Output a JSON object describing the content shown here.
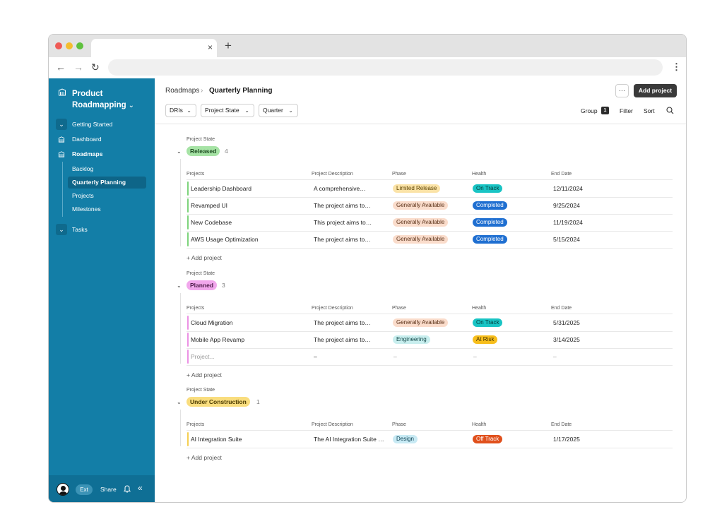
{
  "browser": {
    "tab_close": "×",
    "new_tab": "+",
    "back": "←",
    "forward": "→",
    "reload": "↻",
    "menu": "⋮"
  },
  "sidebar": {
    "app_title": "Product Roadmapping",
    "title_chevron": "⌄",
    "items": [
      {
        "label": "Getting Started",
        "icon": "chevron-down-icon"
      },
      {
        "label": "Dashboard",
        "icon": "building-icon"
      },
      {
        "label": "Roadmaps",
        "icon": "building-icon"
      },
      {
        "label": "Tasks",
        "icon": "chevron-down-icon"
      }
    ],
    "sub_items": [
      "Backlog",
      "Quarterly Planning",
      "Projects",
      "Milestones"
    ],
    "active_sub_item": "Quarterly Planning",
    "footer": {
      "ext_label": "Ext",
      "share_label": "Share",
      "collapse_icon": "«"
    }
  },
  "header": {
    "breadcrumb_parent": "Roadmaps",
    "breadcrumb_sep": "›",
    "breadcrumb_current": "Quarterly Planning",
    "more_label": "···",
    "add_project_label": "Add project",
    "filters": [
      {
        "label": "DRIs",
        "chevron": "⌄"
      },
      {
        "label": "Project State",
        "chevron": "⌄"
      },
      {
        "label": "Quarter",
        "chevron": "⌄"
      }
    ],
    "group_label": "Group",
    "group_count": "1",
    "filter_label": "Filter",
    "sort_label": "Sort"
  },
  "columns": [
    "Projects",
    "Project Description",
    "Phase",
    "Health",
    "End Date"
  ],
  "groups": [
    {
      "caption": "Project State",
      "toggle": "⌄",
      "state": "Released",
      "count": "4",
      "pill_bg": "#a6e3a5",
      "pill_fg": "#1f4d22",
      "bar_color": "#7ed47c",
      "add_label": "+ Add project",
      "rows": [
        {
          "name": "Leadership Dashboard",
          "desc": "A comprehensive…",
          "phase": "Limited Release",
          "phase_bg": "#fbe3a7",
          "phase_fg": "#5a4100",
          "health": "On Track",
          "health_bg": "#19c4c4",
          "health_fg": "#053b3b",
          "date": "12/11/2024"
        },
        {
          "name": "Revamped UI",
          "desc": "The project aims to…",
          "phase": "Generally Available",
          "phase_bg": "#fadccb",
          "phase_fg": "#5a3118",
          "health": "Completed",
          "health_bg": "#1f6fd1",
          "health_fg": "#ffffff",
          "date": "9/25/2024"
        },
        {
          "name": "New Codebase",
          "desc": "This project aims to…",
          "phase": "Generally Available",
          "phase_bg": "#fadccb",
          "phase_fg": "#5a3118",
          "health": "Completed",
          "health_bg": "#1f6fd1",
          "health_fg": "#ffffff",
          "date": "11/19/2024"
        },
        {
          "name": "AWS Usage Optimization",
          "desc": "The project aims to…",
          "phase": "Generally Available",
          "phase_bg": "#fadccb",
          "phase_fg": "#5a3118",
          "health": "Completed",
          "health_bg": "#1f6fd1",
          "health_fg": "#ffffff",
          "date": "5/15/2024"
        }
      ]
    },
    {
      "caption": "Project State",
      "toggle": "⌄",
      "state": "Planned",
      "count": "3",
      "pill_bg": "#f1a7ec",
      "pill_fg": "#4d1c49",
      "bar_color": "#ec92e4",
      "add_label": "+ Add project",
      "rows": [
        {
          "name": "Cloud Migration",
          "desc": "The project aims to…",
          "phase": "Generally Available",
          "phase_bg": "#fadccb",
          "phase_fg": "#5a3118",
          "health": "On Track",
          "health_bg": "#19c4c4",
          "health_fg": "#053b3b",
          "date": "5/31/2025"
        },
        {
          "name": "Mobile App Revamp",
          "desc": "The project aims to…",
          "phase": "Engineering",
          "phase_bg": "#c8eeee",
          "phase_fg": "#14494a",
          "health": "At Risk",
          "health_bg": "#f7be1c",
          "health_fg": "#4a3600",
          "date": "3/14/2025"
        },
        {
          "name": "Project...",
          "desc": "–",
          "phase": "–",
          "health": "–",
          "date": "–",
          "placeholder": true
        }
      ]
    },
    {
      "caption": "Project State",
      "toggle": "⌄",
      "state": "Under Construction",
      "count": "1",
      "pill_bg": "#f9dd7e",
      "pill_fg": "#4a3a00",
      "bar_color": "#f5cf52",
      "add_label": "+ Add project",
      "rows": [
        {
          "name": "AI Integration Suite",
          "desc": "The AI Integration Suite …",
          "phase": "Design",
          "phase_bg": "#c8eaf4",
          "phase_fg": "#0f4456",
          "health": "Off Track",
          "health_bg": "#e0501c",
          "health_fg": "#ffffff",
          "date": "1/17/2025"
        }
      ]
    }
  ]
}
